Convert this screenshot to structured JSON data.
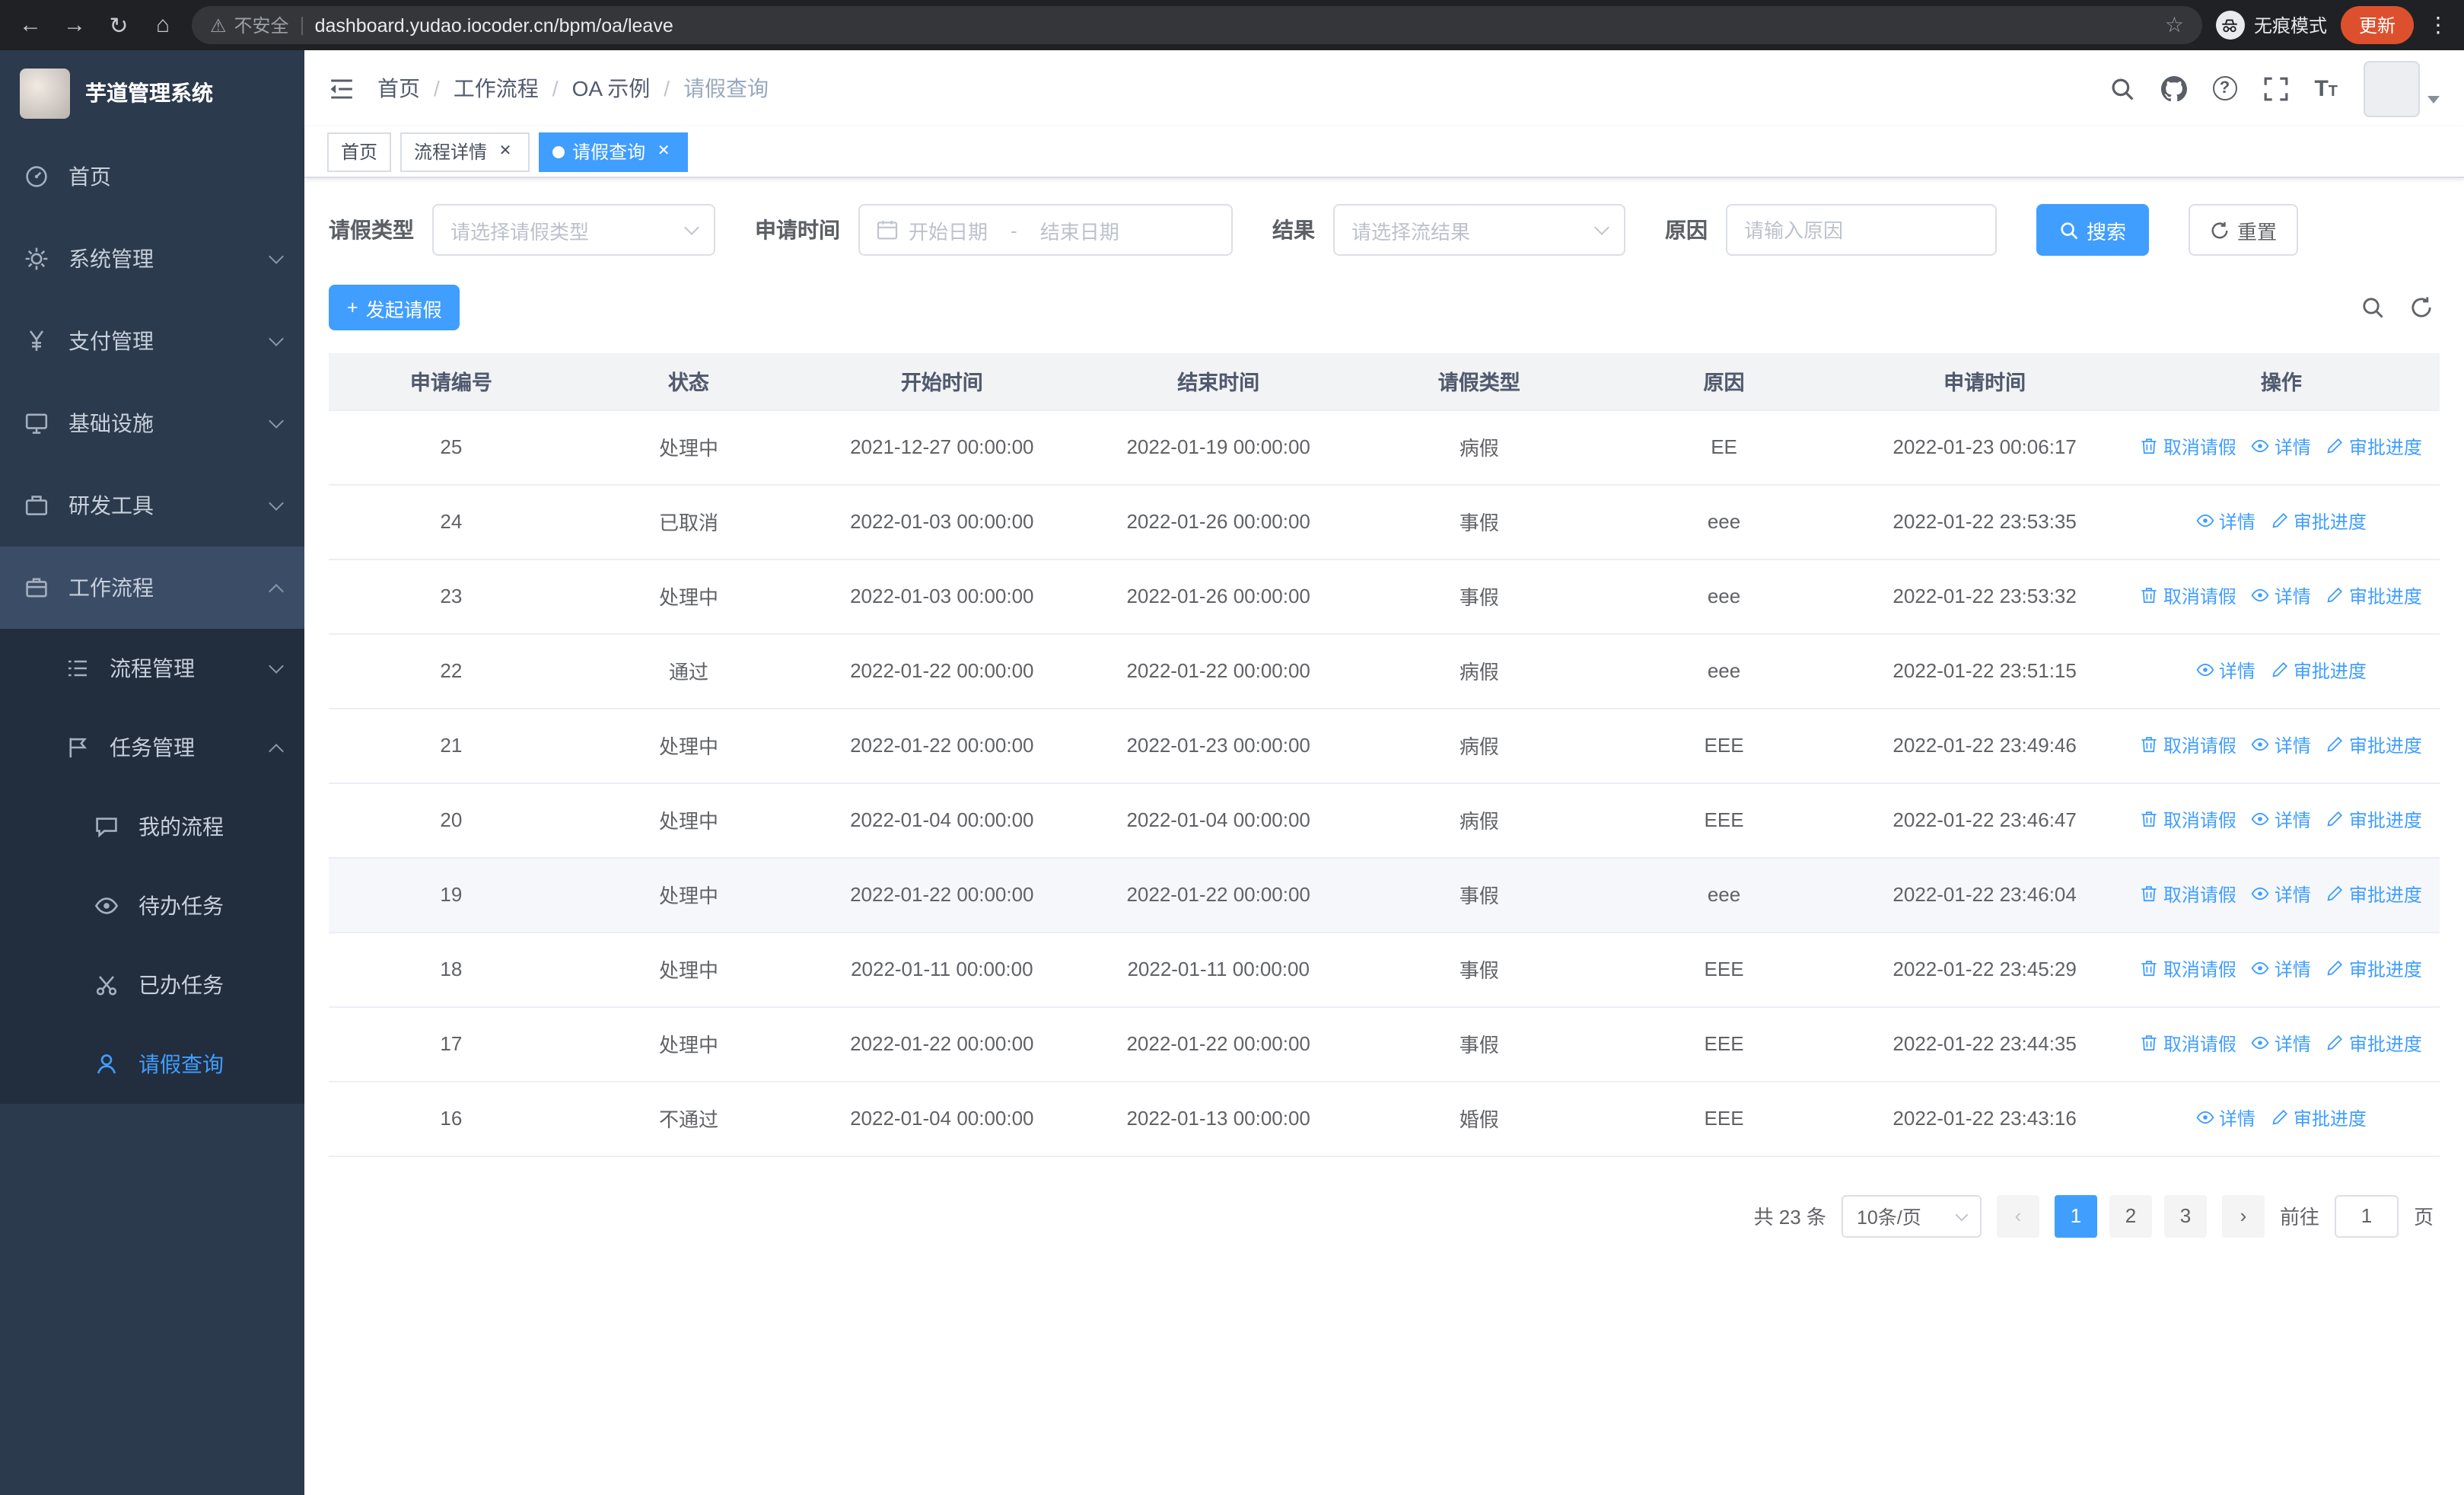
{
  "colors": {
    "accent": "#409eff",
    "update_badge": "#dd502e"
  },
  "browser": {
    "security_label": "不安全",
    "url": "dashboard.yudao.iocoder.cn/bpm/oa/leave",
    "incognito_label": "无痕模式",
    "update_label": "更新"
  },
  "sidebar": {
    "logo_title": "芋道管理系统",
    "items": [
      {
        "label": "首页"
      },
      {
        "label": "系统管理"
      },
      {
        "label": "支付管理"
      },
      {
        "label": "基础设施"
      },
      {
        "label": "研发工具"
      },
      {
        "label": "工作流程"
      }
    ],
    "workflow_children": [
      {
        "label": "流程管理"
      },
      {
        "label": "任务管理"
      }
    ],
    "task_children": [
      {
        "label": "我的流程"
      },
      {
        "label": "待办任务"
      },
      {
        "label": "已办任务"
      },
      {
        "label": "请假查询"
      }
    ]
  },
  "navbar": {
    "breadcrumb": [
      "首页",
      "工作流程",
      "OA 示例",
      "请假查询"
    ],
    "separator": "/"
  },
  "tabs": [
    {
      "label": "首页"
    },
    {
      "label": "流程详情"
    },
    {
      "label": "请假查询"
    }
  ],
  "filters": {
    "leave_type_label": "请假类型",
    "leave_type_placeholder": "请选择请假类型",
    "apply_time_label": "申请时间",
    "date_start_placeholder": "开始日期",
    "date_separator": "-",
    "date_end_placeholder": "结束日期",
    "result_label": "结果",
    "result_placeholder": "请选择流结果",
    "reason_label": "原因",
    "reason_placeholder": "请输入原因",
    "search_button": "搜索",
    "reset_button": "重置"
  },
  "toolbar": {
    "create_button": "发起请假"
  },
  "table": {
    "columns": [
      "申请编号",
      "状态",
      "开始时间",
      "结束时间",
      "请假类型",
      "原因",
      "申请时间",
      "操作"
    ],
    "action_labels": {
      "cancel": "取消请假",
      "detail": "详情",
      "progress": "审批进度"
    },
    "rows": [
      {
        "id": "25",
        "status": "处理中",
        "start": "2021-12-27 00:00:00",
        "end": "2022-01-19 00:00:00",
        "type": "病假",
        "reason": "EE",
        "applied": "2022-01-23 00:06:17",
        "actions": [
          "cancel",
          "detail",
          "progress"
        ]
      },
      {
        "id": "24",
        "status": "已取消",
        "start": "2022-01-03 00:00:00",
        "end": "2022-01-26 00:00:00",
        "type": "事假",
        "reason": "eee",
        "applied": "2022-01-22 23:53:35",
        "actions": [
          "detail",
          "progress"
        ]
      },
      {
        "id": "23",
        "status": "处理中",
        "start": "2022-01-03 00:00:00",
        "end": "2022-01-26 00:00:00",
        "type": "事假",
        "reason": "eee",
        "applied": "2022-01-22 23:53:32",
        "actions": [
          "cancel",
          "detail",
          "progress"
        ]
      },
      {
        "id": "22",
        "status": "通过",
        "start": "2022-01-22 00:00:00",
        "end": "2022-01-22 00:00:00",
        "type": "病假",
        "reason": "eee",
        "applied": "2022-01-22 23:51:15",
        "actions": [
          "detail",
          "progress"
        ]
      },
      {
        "id": "21",
        "status": "处理中",
        "start": "2022-01-22 00:00:00",
        "end": "2022-01-23 00:00:00",
        "type": "病假",
        "reason": "EEE",
        "applied": "2022-01-22 23:49:46",
        "actions": [
          "cancel",
          "detail",
          "progress"
        ]
      },
      {
        "id": "20",
        "status": "处理中",
        "start": "2022-01-04 00:00:00",
        "end": "2022-01-04 00:00:00",
        "type": "病假",
        "reason": "EEE",
        "applied": "2022-01-22 23:46:47",
        "actions": [
          "cancel",
          "detail",
          "progress"
        ]
      },
      {
        "id": "19",
        "status": "处理中",
        "start": "2022-01-22 00:00:00",
        "end": "2022-01-22 00:00:00",
        "type": "事假",
        "reason": "eee",
        "applied": "2022-01-22 23:46:04",
        "actions": [
          "cancel",
          "detail",
          "progress"
        ],
        "highlighted": true
      },
      {
        "id": "18",
        "status": "处理中",
        "start": "2022-01-11 00:00:00",
        "end": "2022-01-11 00:00:00",
        "type": "事假",
        "reason": "EEE",
        "applied": "2022-01-22 23:45:29",
        "actions": [
          "cancel",
          "detail",
          "progress"
        ]
      },
      {
        "id": "17",
        "status": "处理中",
        "start": "2022-01-22 00:00:00",
        "end": "2022-01-22 00:00:00",
        "type": "事假",
        "reason": "EEE",
        "applied": "2022-01-22 23:44:35",
        "actions": [
          "cancel",
          "detail",
          "progress"
        ]
      },
      {
        "id": "16",
        "status": "不通过",
        "start": "2022-01-04 00:00:00",
        "end": "2022-01-13 00:00:00",
        "type": "婚假",
        "reason": "EEE",
        "applied": "2022-01-22 23:43:16",
        "actions": [
          "detail",
          "progress"
        ]
      }
    ]
  },
  "pagination": {
    "total_label": "共 23 条",
    "page_size_label": "10条/页",
    "pages": [
      "1",
      "2",
      "3"
    ],
    "active_page": "1",
    "goto_label": "前往",
    "goto_value": "1",
    "page_unit_label": "页"
  }
}
